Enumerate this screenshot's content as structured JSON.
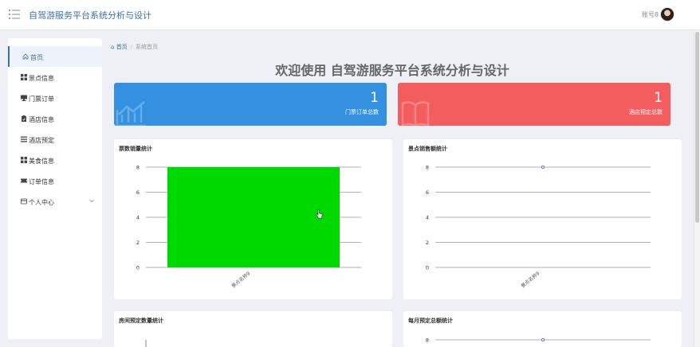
{
  "header": {
    "title": "自驾游服务平台系统分析与设计",
    "user": "账号8"
  },
  "sidebar": {
    "items": [
      {
        "label": "首页",
        "icon": "home-icon"
      },
      {
        "label": "景点信息",
        "icon": "grid-icon"
      },
      {
        "label": "门票订单",
        "icon": "monitor-icon"
      },
      {
        "label": "酒店信息",
        "icon": "clipboard-icon"
      },
      {
        "label": "酒店预定",
        "icon": "list-icon"
      },
      {
        "label": "美食信息",
        "icon": "grid-icon"
      },
      {
        "label": "订单信息",
        "icon": "ticket-icon"
      },
      {
        "label": "个人中心",
        "icon": "card-icon"
      }
    ]
  },
  "breadcrumb": {
    "home": "首页",
    "sep": "/",
    "current": "系统首页"
  },
  "welcome": "欢迎使用 自驾游服务平台系统分析与设计",
  "stats": [
    {
      "value": "1",
      "label": "门票订单总数",
      "color": "#3391e0",
      "icon": "chart-icon"
    },
    {
      "value": "1",
      "label": "酒店预定总数",
      "color": "#f45d5d",
      "icon": "book-icon"
    }
  ],
  "panels": {
    "p1": "票数销量统计",
    "p2": "景点销售额统计",
    "p3": "房间预定数量统计",
    "p4": "每月预定总额统计"
  },
  "chart_data": [
    {
      "type": "bar",
      "title": "票数销量统计",
      "categories": [
        "景点名称9"
      ],
      "values": [
        8
      ],
      "ylim": [
        0,
        8
      ],
      "yticks": [
        0,
        2,
        4,
        6,
        8
      ],
      "bar_color": "#00d900"
    },
    {
      "type": "line",
      "title": "景点销售额统计",
      "categories": [
        "景点名称9"
      ],
      "values": [
        8
      ],
      "ylim": [
        0,
        8
      ],
      "yticks": [
        0,
        2,
        4,
        6,
        8
      ],
      "line_color": "#5470c6"
    },
    {
      "type": "bar",
      "title": "房间预定数量统计",
      "categories": [],
      "values": []
    },
    {
      "type": "line",
      "title": "每月预定总额统计",
      "categories": [],
      "values": [
        8
      ],
      "ylim": [
        0,
        8
      ],
      "yticks": [
        8
      ],
      "line_color": "#5470c6"
    }
  ]
}
